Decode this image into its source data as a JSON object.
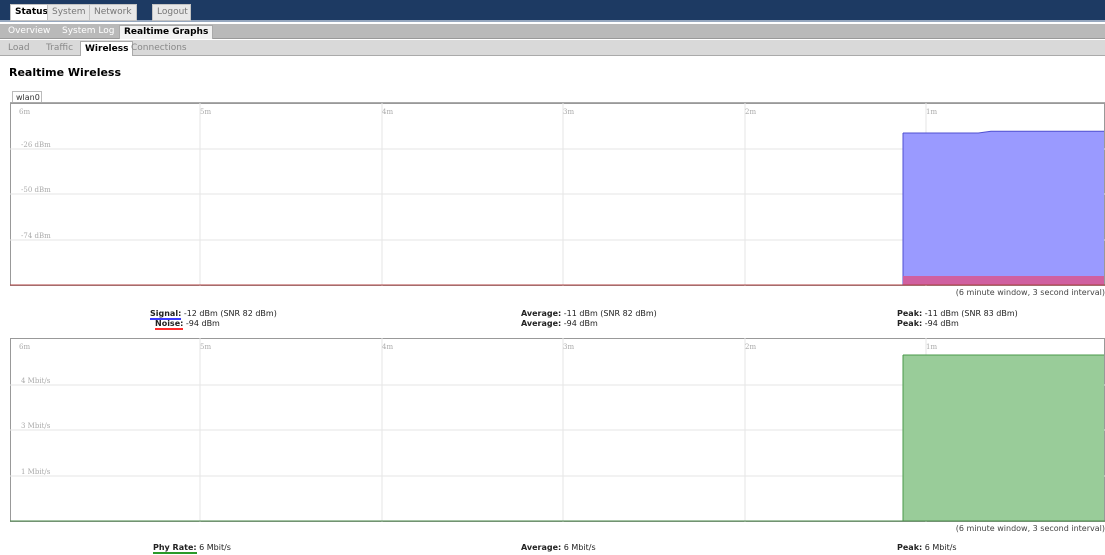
{
  "nav": {
    "top": [
      "Status",
      "System",
      "Network",
      "Logout"
    ],
    "sub": [
      "Overview",
      "System Log",
      "Realtime Graphs"
    ],
    "sub2": [
      "Load",
      "Traffic",
      "Wireless",
      "Connections"
    ]
  },
  "page": {
    "title": "Realtime Wireless",
    "interface_tab": "wlan0"
  },
  "colors": {
    "signal": "#9a9aff",
    "signal_line": "#5050d0",
    "noise": "#d060a0",
    "rate": "#99cc99",
    "rate_line": "#4a9a4a"
  },
  "chart_data": [
    {
      "type": "area",
      "x_ticks": [
        "6m",
        "5m",
        "4m",
        "3m",
        "2m",
        "1m"
      ],
      "y_ticks": [
        "-26 dBm",
        "-50 dBm",
        "-74 dBm"
      ],
      "series": [
        {
          "name": "Signal",
          "color": "#9a9aff",
          "values": [
            -12,
            -12,
            -12,
            -12,
            -12,
            -12,
            -12,
            -11,
            -11,
            -11,
            -11,
            -11,
            -11,
            -11,
            -11,
            -11,
            -11
          ]
        },
        {
          "name": "Noise",
          "color": "#d060a0",
          "values": [
            -94,
            -94,
            -94,
            -94,
            -94,
            -94,
            -94,
            -94,
            -94,
            -94,
            -94,
            -94,
            -94,
            -94,
            -94,
            -94,
            -94
          ]
        }
      ],
      "note": "(6 minute window, 3 second interval)"
    },
    {
      "type": "area",
      "x_ticks": [
        "6m",
        "5m",
        "4m",
        "3m",
        "2m",
        "1m"
      ],
      "y_ticks": [
        "4 Mbit/s",
        "3 Mbit/s",
        "1 Mbit/s"
      ],
      "series": [
        {
          "name": "Phy Rate",
          "color": "#99cc99",
          "values": [
            6,
            6,
            6,
            6,
            6,
            6,
            6,
            6,
            6,
            6,
            6,
            6,
            6,
            6,
            6,
            6,
            6
          ]
        }
      ],
      "note": "(6 minute window, 3 second interval)"
    }
  ],
  "legend_wireless": {
    "signal_label": "Signal:",
    "signal_value": "-12 dBm (SNR 82 dBm)",
    "noise_label": "Noise:",
    "noise_value": "-94 dBm",
    "avg_label": "Average:",
    "avg_signal": "-11 dBm (SNR 82 dBm)",
    "avg_noise": "-94 dBm",
    "peak_label": "Peak:",
    "peak_signal": "-11 dBm (SNR 83 dBm)",
    "peak_noise": "-94 dBm"
  },
  "legend_rate": {
    "phy_label": "Phy Rate:",
    "phy_value": "6 Mbit/s",
    "avg_label": "Average:",
    "avg_value": "6 Mbit/s",
    "peak_label": "Peak:",
    "peak_value": "6 Mbit/s"
  }
}
